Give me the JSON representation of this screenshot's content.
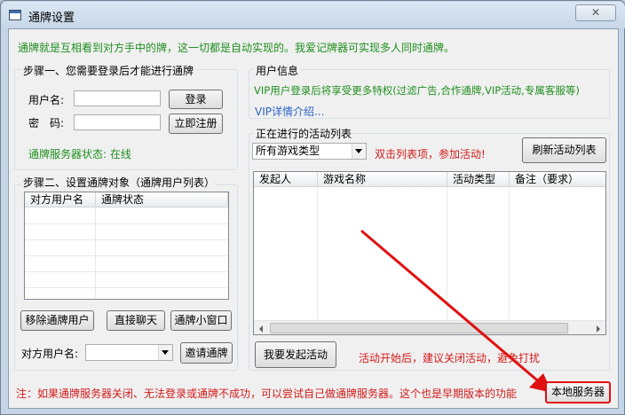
{
  "window": {
    "title": "通牌设置",
    "close_label": "✕"
  },
  "intro": "通牌就是互相看到对方手中的牌，这一切都是自动实现的。我爱记牌器可实现多人同时通牌。",
  "step1": {
    "title": "步骤一、您需要登录后才能进行通牌",
    "username_label": "用户名:",
    "username_value": "",
    "password_label": "密　码:",
    "password_value": "",
    "login_button": "登录",
    "register_button": "立即注册",
    "server_status": "通牌服务器状态: 在线"
  },
  "userinfo": {
    "title": "用户信息",
    "vip_promo": "VIP用户登录后将享受更多特权(过滤广告,合作通牌,VIP活动,专属客服等)",
    "vip_link": "VIP详情介绍..."
  },
  "step2": {
    "title": "步骤二、设置通牌对象（通牌用户列表）",
    "columns": [
      "对方用户名",
      "通牌状态"
    ],
    "rows": [],
    "remove_button": "移除通牌用户",
    "chat_button": "直接聊天",
    "mini_window_button": "通牌小窗口",
    "target_label": "对方用户名:",
    "target_value": "",
    "invite_button": "邀请通牌"
  },
  "activities": {
    "title": "正在进行的活动列表",
    "filter_selected": "所有游戏类型",
    "hint": "双击列表项，参加活动!",
    "refresh_button": "刷新活动列表",
    "columns": [
      "发起人",
      "游戏名称",
      "活动类型",
      "备注（要求）"
    ],
    "rows": [],
    "create_button": "我要发起活动",
    "close_hint": "活动开始后，建议关闭活动，避免打扰"
  },
  "footer": {
    "note": "注：如果通牌服务器关闭、无法登录或通牌不成功，可以尝试自己做通牌服务器。这个也是早期版本的功能",
    "local_server_button": "本地服务器"
  },
  "colors": {
    "green_text": "#1f8f1f",
    "red_text": "#d21b1b",
    "link_blue": "#2a62c6",
    "highlight_red": "#e01010"
  }
}
